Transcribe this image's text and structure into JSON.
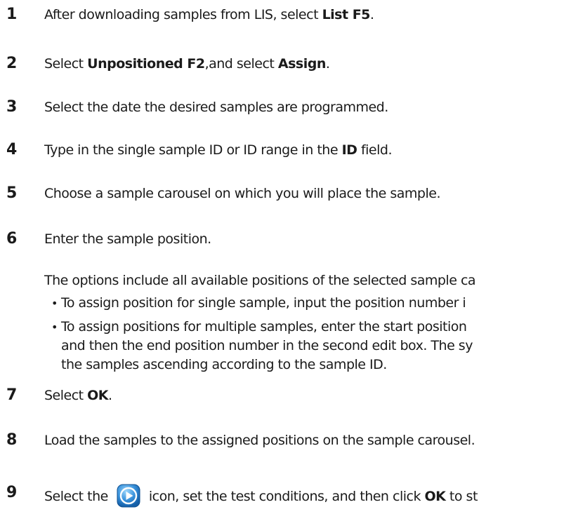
{
  "steps": [
    {
      "num": "1",
      "parts": [
        {
          "t": "After downloading samples from LIS, select "
        },
        {
          "t": "List F5",
          "b": true
        },
        {
          "t": "."
        }
      ]
    },
    {
      "num": "2",
      "parts": [
        {
          "t": "Select "
        },
        {
          "t": "Unpositioned F2",
          "b": true
        },
        {
          "t": ",and select "
        },
        {
          "t": "Assign",
          "b": true
        },
        {
          "t": "."
        }
      ]
    },
    {
      "num": "3",
      "parts": [
        {
          "t": "Select the date the desired samples are programmed."
        }
      ]
    },
    {
      "num": "4",
      "parts": [
        {
          "t": "Type in the single sample ID or ID range in the "
        },
        {
          "t": "ID",
          "b": true
        },
        {
          "t": " field."
        }
      ]
    },
    {
      "num": "5",
      "parts": [
        {
          "t": "Choose a sample carousel on which you will place the sample."
        }
      ]
    },
    {
      "num": "6",
      "parts": [
        {
          "t": "Enter the sample position."
        }
      ],
      "note": "The options include all available positions of the selected sample ca",
      "bullets": [
        {
          "lines": [
            "To assign position for single sample, input the position number i"
          ]
        },
        {
          "lines": [
            "To assign positions for multiple samples, enter the start position",
            "and then the end position number in the second edit box. The sy",
            "the samples ascending according to the sample ID."
          ]
        }
      ]
    },
    {
      "num": "7",
      "parts": [
        {
          "t": "Select "
        },
        {
          "t": "OK",
          "b": true
        },
        {
          "t": "."
        }
      ]
    },
    {
      "num": "8",
      "parts": [
        {
          "t": "Load the samples to the assigned positions on the sample carousel."
        }
      ]
    },
    {
      "num": "9",
      "before_icon": "Select the",
      "icon": "run-play-icon",
      "after_parts": [
        {
          "t": "icon, set the test conditions, and then click "
        },
        {
          "t": "OK",
          "b": true
        },
        {
          "t": " to st"
        }
      ]
    }
  ],
  "colors": {
    "text": "#1a1a1a",
    "icon_blue": "#1f78c8",
    "icon_light": "#7fc4f2"
  }
}
